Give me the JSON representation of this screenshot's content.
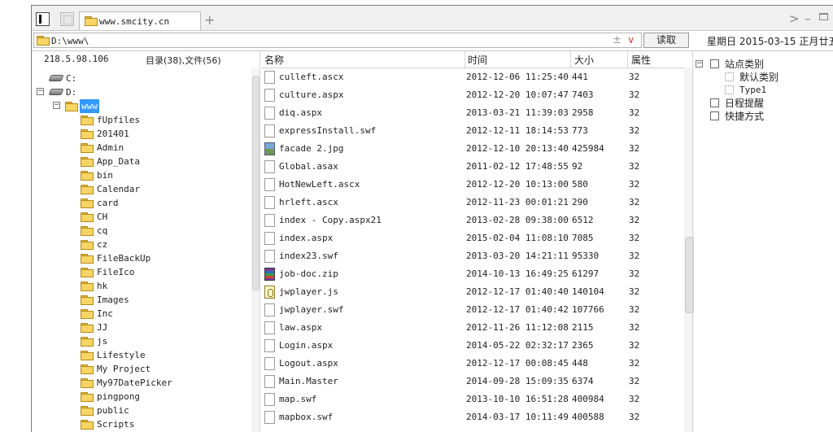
{
  "tab": {
    "title": "www.smcity.cn",
    "add": "+"
  },
  "window": {
    "next": ">",
    "minimize": "–"
  },
  "address": {
    "value": "D:\\www\\",
    "plusminus": "±",
    "dropdown": "∨",
    "read_button": "读取"
  },
  "date": {
    "text": "星期日 2015-03-15 正月廿五"
  },
  "tree": {
    "ip": "218.5.98.106",
    "counts": "目录(38),文件(56)",
    "drives": [
      {
        "label": "C:"
      },
      {
        "label": "D:"
      }
    ],
    "selected": "www",
    "folders": [
      "fUpfiles",
      "201401",
      "Admin",
      "App_Data",
      "bin",
      "Calendar",
      "card",
      "CH",
      "cq",
      "cz",
      "FileBackUp",
      "FileIco",
      "hk",
      "Images",
      "Inc",
      "JJ",
      "js",
      "Lifestyle",
      "My Project",
      "My97DatePicker",
      "pingpong",
      "public",
      "Scripts"
    ]
  },
  "files": {
    "columns": {
      "name": "名称",
      "time": "时间",
      "size": "大小",
      "attr": "属性"
    },
    "rows": [
      {
        "name": "culleft.ascx",
        "time": "2012-12-06 11:25:40",
        "size": "441",
        "attr": "32",
        "icon": "file"
      },
      {
        "name": "culture.aspx",
        "time": "2012-12-20 10:07:47",
        "size": "7403",
        "attr": "32",
        "icon": "file"
      },
      {
        "name": "diq.aspx",
        "time": "2013-03-21 11:39:03",
        "size": "2958",
        "attr": "32",
        "icon": "file"
      },
      {
        "name": "expressInstall.swf",
        "time": "2012-12-11 18:14:53",
        "size": "773",
        "attr": "32",
        "icon": "file"
      },
      {
        "name": "facade 2.jpg",
        "time": "2012-12-10 20:13:40",
        "size": "425984",
        "attr": "32",
        "icon": "img"
      },
      {
        "name": "Global.asax",
        "time": "2011-02-12 17:48:55",
        "size": "92",
        "attr": "32",
        "icon": "file"
      },
      {
        "name": "HotNewLeft.ascx",
        "time": "2012-12-20 10:13:00",
        "size": "580",
        "attr": "32",
        "icon": "file"
      },
      {
        "name": "hrleft.ascx",
        "time": "2012-11-23 00:01:21",
        "size": "290",
        "attr": "32",
        "icon": "file"
      },
      {
        "name": "index - Copy.aspx21",
        "time": "2013-02-28 09:38:00",
        "size": "6512",
        "attr": "32",
        "icon": "file"
      },
      {
        "name": "index.aspx",
        "time": "2015-02-04 11:08:10",
        "size": "7085",
        "attr": "32",
        "icon": "file"
      },
      {
        "name": "index23.swf",
        "time": "2013-03-20 14:21:11",
        "size": "95330",
        "attr": "32",
        "icon": "file"
      },
      {
        "name": "job-doc.zip",
        "time": "2014-10-13 16:49:25",
        "size": "61297",
        "attr": "32",
        "icon": "zip"
      },
      {
        "name": "jwplayer.js",
        "time": "2012-12-17 01:40:40",
        "size": "140104",
        "attr": "32",
        "icon": "js"
      },
      {
        "name": "jwplayer.swf",
        "time": "2012-12-17 01:40:42",
        "size": "107766",
        "attr": "32",
        "icon": "file"
      },
      {
        "name": "law.aspx",
        "time": "2012-11-26 11:12:08",
        "size": "2115",
        "attr": "32",
        "icon": "file"
      },
      {
        "name": "Login.aspx",
        "time": "2014-05-22 02:32:17",
        "size": "2365",
        "attr": "32",
        "icon": "file"
      },
      {
        "name": "Logout.aspx",
        "time": "2012-12-17 00:08:45",
        "size": "448",
        "attr": "32",
        "icon": "file"
      },
      {
        "name": "Main.Master",
        "time": "2014-09-28 15:09:35",
        "size": "6374",
        "attr": "32",
        "icon": "file"
      },
      {
        "name": "map.swf",
        "time": "2013-10-10 16:51:28",
        "size": "400984",
        "attr": "32",
        "icon": "file"
      },
      {
        "name": "mapbox.swf",
        "time": "2014-03-17 10:11:49",
        "size": "400588",
        "attr": "32",
        "icon": "file"
      }
    ]
  },
  "sites": {
    "root": "站点类别",
    "root_toggle": "−",
    "children": [
      "默认类别",
      "Type1"
    ],
    "schedule": "日程提醒",
    "shortcuts": "快捷方式"
  }
}
